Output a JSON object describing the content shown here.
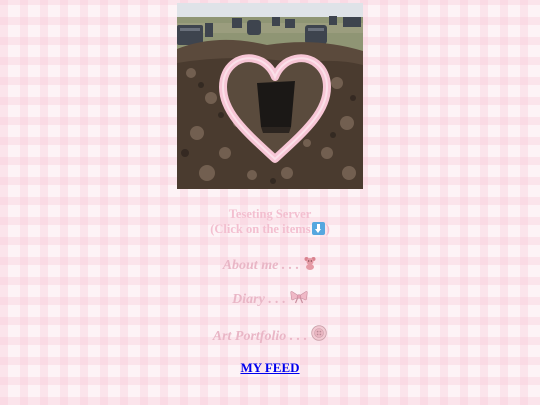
{
  "header_image": {
    "alt": "heart-shaped grave photo"
  },
  "server": {
    "title": "Teseting Server",
    "instruction_prefix": "(Click on the items",
    "instruction_suffix": ")",
    "arrow_icon": "down-arrow-icon"
  },
  "menu": [
    {
      "label": "About me . . .",
      "icon": "teddy-bear-icon"
    },
    {
      "label": "Diary . . .",
      "icon": "bow-icon"
    },
    {
      "label": "Art Portfolio . . .",
      "icon": "button-icon"
    }
  ],
  "feed": {
    "label": "MY FEED"
  },
  "colors": {
    "accent_pink": "#f3bfd0",
    "heart_pink": "#f7c6d6",
    "link_blue": "#0000ee",
    "icon_blue": "#55a7df"
  }
}
